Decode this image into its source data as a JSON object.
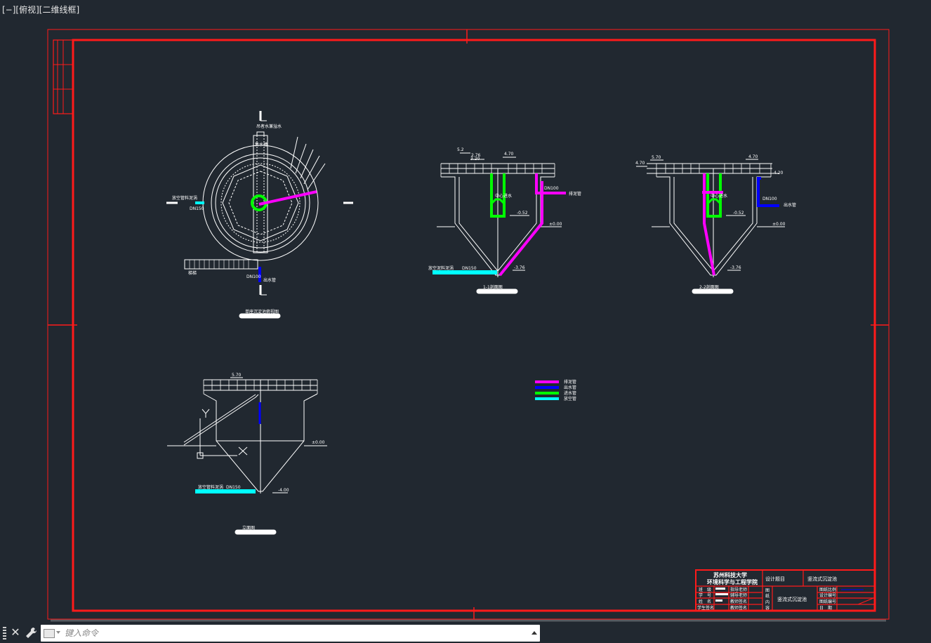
{
  "viewport": {
    "label": "[−][俯视][二维线框]"
  },
  "drawing": {
    "plan_view": {
      "label_top": "吊者水兼溢水",
      "label_left": "放空管料泥涡",
      "label_dn150": "DN150",
      "label_dn100": "DN100",
      "label_outlet": "出水管",
      "label_stairs": "梯梯",
      "label_inner": "集水槽",
      "title": "单座沉淀池俯视图"
    },
    "section_1_1": {
      "label_center": "中心进水",
      "label_dn100": "DN100",
      "label_sludge": "排泥管",
      "label_drain": "放空泥料泥涡",
      "label_dn150": "DN150",
      "title": "1-1剖面图",
      "elevations": [
        "5.2",
        "2.76",
        "4.70",
        "3.20",
        "-0.52",
        "±0.00",
        "-3.76"
      ]
    },
    "section_2_2": {
      "label_center": "中心进水",
      "label_dn100": "DN100",
      "label_outlet": "出水管",
      "title": "2-2剖面图",
      "elevations": [
        "5.70",
        "4.70",
        "4.70",
        "4.20",
        "-0.52",
        "±0.00",
        "-3.76"
      ]
    },
    "elevation_view": {
      "label_top": "5.70",
      "label_drain": "放空管料泥涡",
      "label_dn150": "DN150",
      "label_zero": "±0.00",
      "label_bottom": "-4.00",
      "title": "立面图"
    },
    "legend": {
      "items": [
        {
          "label": "排泥管",
          "color": "#ff00ff"
        },
        {
          "label": "出水管",
          "color": "#0000ff"
        },
        {
          "label": "进水管",
          "color": "#00ff00"
        },
        {
          "label": "放空管",
          "color": "#00ffff"
        }
      ]
    },
    "title_block": {
      "school": "苏州科技大学",
      "college": "环境科学与工程学院",
      "design_topic_label": "设计题目",
      "design_topic": "竖流式沉淀池",
      "drawing_name": "竖流式沉淀池",
      "row_labels": [
        "班　级",
        "学　号",
        "姓　名",
        "学生签名"
      ],
      "mid_labels": [
        "指导老师",
        "辅导老师",
        "教师签名",
        "教师签名"
      ],
      "right_labels": [
        "图纸比例",
        "设计编号",
        "图纸编号",
        "日　期"
      ],
      "side_labels": [
        "图",
        "纸",
        "内",
        "容"
      ]
    },
    "colors": {
      "background": "#212830",
      "frame": "#ff0000",
      "line": "#ffffff",
      "sludge_pipe": "#ff00ff",
      "outlet_pipe": "#0000ff",
      "inlet_pipe": "#00ff00",
      "drain_pipe": "#00ffff"
    }
  },
  "command_bar": {
    "placeholder": "键入命令",
    "close_icon": "close-icon",
    "settings_icon": "wrench-icon"
  }
}
